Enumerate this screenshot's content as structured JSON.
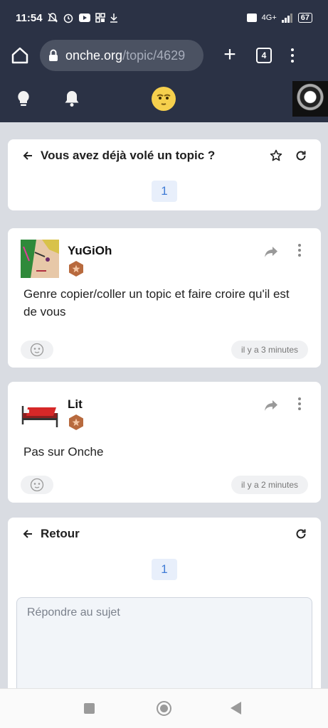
{
  "status_bar": {
    "time": "11:54",
    "battery": "67",
    "network": "4G+"
  },
  "browser": {
    "url_host": "onche.org",
    "url_path": "/topic/4629",
    "tab_count": "4"
  },
  "topic": {
    "title": "Vous avez déjà volé un topic ?",
    "page": "1"
  },
  "posts": [
    {
      "author": "YuGiOh",
      "body": "Genre copier/coller un topic et faire croire qu'il est de vous",
      "time": "il y a 3 minutes"
    },
    {
      "author": "Lit",
      "body": "Pas sur Onche",
      "time": "il y a 2 minutes"
    }
  ],
  "reply": {
    "back_label": "Retour",
    "page": "1",
    "placeholder": "Répondre au sujet"
  },
  "colors": {
    "header": "#2b3245",
    "background": "#d9dce2",
    "page_badge": "#3f7bd6",
    "rank_badge": "#b86a3e"
  }
}
